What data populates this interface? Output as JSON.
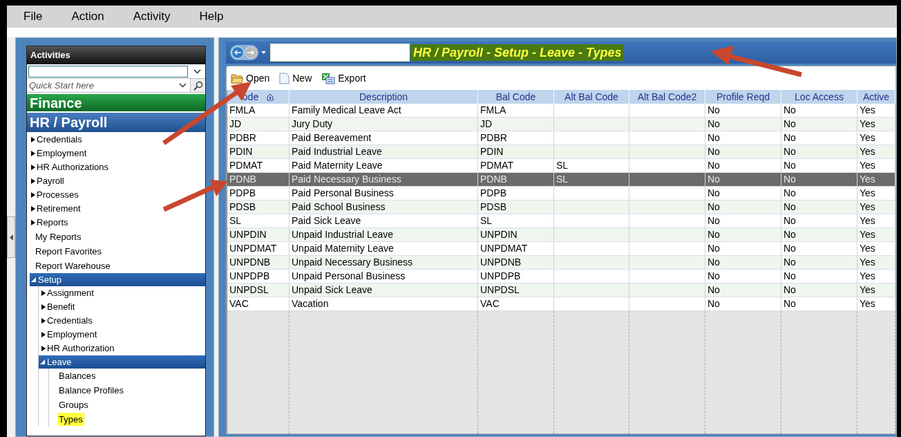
{
  "menu": [
    "File",
    "Action",
    "Activity",
    "Help"
  ],
  "sidebar": {
    "title": "Activities",
    "search": {
      "placeholder": "Quick Start here"
    },
    "modules": [
      {
        "label": "Finance",
        "kind": "finance"
      },
      {
        "label": "HR / Payroll",
        "kind": "hr"
      }
    ],
    "items": [
      {
        "label": "Credentials",
        "kind": "folder",
        "expanded": false
      },
      {
        "label": "Employment",
        "kind": "folder",
        "expanded": false
      },
      {
        "label": "HR Authorizations",
        "kind": "folder",
        "expanded": false
      },
      {
        "label": "Payroll",
        "kind": "folder",
        "expanded": false
      },
      {
        "label": "Processes",
        "kind": "folder",
        "expanded": false
      },
      {
        "label": "Retirement",
        "kind": "folder",
        "expanded": false
      },
      {
        "label": "Reports",
        "kind": "folder",
        "expanded": false
      },
      {
        "label": "My Reports",
        "kind": "link",
        "selected": false
      },
      {
        "label": "Report Favorites",
        "kind": "link",
        "selected": false
      },
      {
        "label": "Report Warehouse",
        "kind": "link",
        "selected": false
      },
      {
        "label": "Setup",
        "kind": "folder",
        "expanded": true,
        "children": [
          {
            "label": "Assignment",
            "kind": "folder",
            "expanded": false
          },
          {
            "label": "Benefit",
            "kind": "folder",
            "expanded": false
          },
          {
            "label": "Credentials",
            "kind": "folder",
            "expanded": false
          },
          {
            "label": "Employment",
            "kind": "folder",
            "expanded": false
          },
          {
            "label": "HR Authorization",
            "kind": "folder",
            "expanded": false
          },
          {
            "label": "Leave",
            "kind": "folder",
            "expanded": true,
            "children": [
              {
                "label": "Balances",
                "kind": "link",
                "selected": false
              },
              {
                "label": "Balance Profiles",
                "kind": "link",
                "selected": false
              },
              {
                "label": "Groups",
                "kind": "link",
                "selected": false
              },
              {
                "label": "Types",
                "kind": "link",
                "selected": true
              }
            ]
          }
        ]
      }
    ]
  },
  "breadcrumb": "HR / Payroll - Setup - Leave - Types",
  "toolbar": [
    {
      "label": "Open",
      "kind": "open"
    },
    {
      "label": "New",
      "kind": "new"
    },
    {
      "label": "Export",
      "kind": "export"
    }
  ],
  "table": {
    "columns": [
      "ode",
      "Description",
      "Bal Code",
      "Alt Bal Code",
      "Alt Bal Code2",
      "Profile Reqd",
      "Loc Access",
      "Active"
    ],
    "rows": [
      {
        "cells": [
          "FMLA",
          "Family Medical Leave Act",
          "FMLA",
          "",
          "",
          "No",
          "No",
          "Yes"
        ],
        "selected": false
      },
      {
        "cells": [
          "JD",
          "Jury Duty",
          "JD",
          "",
          "",
          "No",
          "No",
          "Yes"
        ],
        "selected": false
      },
      {
        "cells": [
          "PDBR",
          "Paid Bereavement",
          "PDBR",
          "",
          "",
          "No",
          "No",
          "Yes"
        ],
        "selected": false
      },
      {
        "cells": [
          "PDIN",
          "Paid Industrial Leave",
          "PDIN",
          "",
          "",
          "No",
          "No",
          "Yes"
        ],
        "selected": false
      },
      {
        "cells": [
          "PDMAT",
          "Paid Maternity Leave",
          "PDMAT",
          "SL",
          "",
          "No",
          "No",
          "Yes"
        ],
        "selected": false
      },
      {
        "cells": [
          "PDNB",
          "Paid Necessary Business",
          "PDNB",
          "SL",
          "",
          "No",
          "No",
          "Yes"
        ],
        "selected": true
      },
      {
        "cells": [
          "PDPB",
          "Paid Personal Business",
          "PDPB",
          "",
          "",
          "No",
          "No",
          "Yes"
        ],
        "selected": false
      },
      {
        "cells": [
          "PDSB",
          "Paid School Business",
          "PDSB",
          "",
          "",
          "No",
          "No",
          "Yes"
        ],
        "selected": false
      },
      {
        "cells": [
          "SL",
          "Paid Sick Leave",
          "SL",
          "",
          "",
          "No",
          "No",
          "Yes"
        ],
        "selected": false
      },
      {
        "cells": [
          "UNPDIN",
          "Unpaid Industrial Leave",
          "UNPDIN",
          "",
          "",
          "No",
          "No",
          "Yes"
        ],
        "selected": false
      },
      {
        "cells": [
          "UNPDMAT",
          "Unpaid Maternity Leave",
          "UNPDMAT",
          "",
          "",
          "No",
          "No",
          "Yes"
        ],
        "selected": false
      },
      {
        "cells": [
          "UNPDNB",
          "Unpaid Necessary Business",
          "UNPDNB",
          "",
          "",
          "No",
          "No",
          "Yes"
        ],
        "selected": false
      },
      {
        "cells": [
          "UNPDPB",
          "Unpaid Personal Business",
          "UNPDPB",
          "",
          "",
          "No",
          "No",
          "Yes"
        ],
        "selected": false
      },
      {
        "cells": [
          "UNPDSL",
          "Unpaid Sick Leave",
          "UNPDSL",
          "",
          "",
          "No",
          "No",
          "Yes"
        ],
        "selected": false
      },
      {
        "cells": [
          "VAC",
          "Vacation",
          "VAC",
          "",
          "",
          "No",
          "No",
          "Yes"
        ],
        "selected": false
      }
    ]
  }
}
